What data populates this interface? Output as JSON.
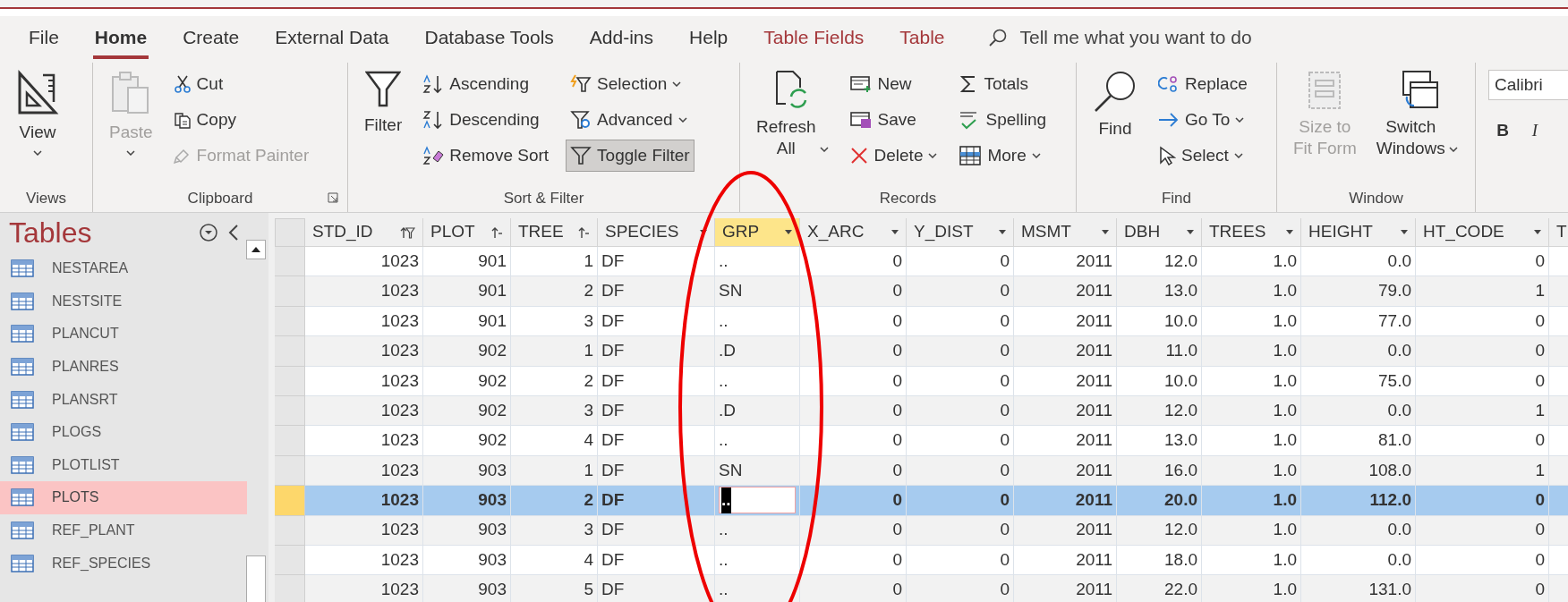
{
  "tabs": [
    {
      "label": "File",
      "selected": false,
      "kind": "normal"
    },
    {
      "label": "Home",
      "selected": true,
      "kind": "normal"
    },
    {
      "label": "Create",
      "selected": false,
      "kind": "normal"
    },
    {
      "label": "External Data",
      "selected": false,
      "kind": "normal"
    },
    {
      "label": "Database Tools",
      "selected": false,
      "kind": "normal"
    },
    {
      "label": "Add-ins",
      "selected": false,
      "kind": "normal"
    },
    {
      "label": "Help",
      "selected": false,
      "kind": "normal"
    },
    {
      "label": "Table Fields",
      "selected": false,
      "kind": "contextual"
    },
    {
      "label": "Table",
      "selected": false,
      "kind": "contextual"
    }
  ],
  "search": {
    "placeholder": "Tell me what you want to do"
  },
  "ribbon_groups": [
    {
      "label": "Views",
      "columns": [
        [
          {
            "label": "View",
            "caret": true
          }
        ]
      ]
    },
    {
      "label": "Clipboard",
      "launcher": true,
      "columns": [
        [
          {
            "label": "Paste",
            "caret": true,
            "disabled": true
          }
        ],
        [
          {
            "label": "Cut"
          },
          {
            "label": "Copy"
          },
          {
            "label": "Format Painter",
            "disabled": true
          }
        ]
      ]
    },
    {
      "label": "Sort & Filter",
      "columns": [
        [
          {
            "label": "Filter"
          }
        ],
        [
          {
            "label": "Ascending"
          },
          {
            "label": "Descending"
          },
          {
            "label": "Remove Sort"
          }
        ],
        [
          {
            "label": "Selection",
            "caret": true
          },
          {
            "label": "Advanced",
            "caret": true
          },
          {
            "label": "Toggle Filter",
            "pressed": true
          }
        ]
      ]
    },
    {
      "label": "Records",
      "columns": [
        [
          {
            "label": "Refresh\nAll",
            "caret": true
          }
        ],
        [
          {
            "label": "New"
          },
          {
            "label": "Save"
          },
          {
            "label": "Delete",
            "caret": true
          }
        ],
        [
          {
            "label": "Totals"
          },
          {
            "label": "Spelling"
          },
          {
            "label": "More",
            "caret": true
          }
        ]
      ]
    },
    {
      "label": "Find",
      "columns": [
        [
          {
            "label": "Find"
          }
        ],
        [
          {
            "label": "Replace"
          },
          {
            "label": "Go To",
            "caret": true
          },
          {
            "label": "Select",
            "caret": true
          }
        ]
      ]
    },
    {
      "label": "Window",
      "columns": [
        [
          {
            "label": "Size to\nFit Form",
            "disabled": true
          }
        ],
        [
          {
            "label": "Switch\nWindows",
            "caret": true
          }
        ]
      ]
    }
  ],
  "font_group": {
    "font": "Calibri",
    "buttons": [
      "B",
      "I"
    ]
  },
  "navigation": {
    "title": "Tables",
    "items": [
      {
        "label": "NESTAREA",
        "selected": false
      },
      {
        "label": "NESTSITE",
        "selected": false
      },
      {
        "label": "PLANCUT",
        "selected": false
      },
      {
        "label": "PLANRES",
        "selected": false
      },
      {
        "label": "PLANSRT",
        "selected": false
      },
      {
        "label": "PLOGS",
        "selected": false
      },
      {
        "label": "PLOTLIST",
        "selected": false
      },
      {
        "label": "PLOTS",
        "selected": true
      },
      {
        "label": "REF_PLANT",
        "selected": false
      },
      {
        "label": "REF_SPECIES",
        "selected": false
      }
    ]
  },
  "table": {
    "columns": [
      {
        "label": "STD_ID",
        "kind": "number",
        "sorted": true,
        "filtered": true,
        "selected": false
      },
      {
        "label": "PLOT",
        "kind": "number",
        "sorted": true,
        "selected": false
      },
      {
        "label": "TREE",
        "kind": "number",
        "sorted": true,
        "selected": false
      },
      {
        "label": "SPECIES",
        "kind": "text",
        "selected": false
      },
      {
        "label": "GRP",
        "kind": "text",
        "selected": true
      },
      {
        "label": "X_ARC",
        "kind": "number",
        "selected": false
      },
      {
        "label": "Y_DIST",
        "kind": "number",
        "selected": false
      },
      {
        "label": "MSMT",
        "kind": "number",
        "selected": false
      },
      {
        "label": "DBH",
        "kind": "number",
        "selected": false
      },
      {
        "label": "TREES",
        "kind": "number",
        "selected": false
      },
      {
        "label": "HEIGHT",
        "kind": "number",
        "selected": false
      },
      {
        "label": "HT_CODE",
        "kind": "number",
        "selected": false
      },
      {
        "label": "T",
        "kind": "cut",
        "selected": false
      }
    ],
    "rows": [
      {
        "selected": false,
        "cells": [
          "1023",
          "901",
          "1",
          "DF",
          "..",
          "0",
          "0",
          "2011",
          "12.0",
          "1.0",
          "0.0",
          "0"
        ]
      },
      {
        "selected": false,
        "cells": [
          "1023",
          "901",
          "2",
          "DF",
          "SN",
          "0",
          "0",
          "2011",
          "13.0",
          "1.0",
          "79.0",
          "1"
        ]
      },
      {
        "selected": false,
        "cells": [
          "1023",
          "901",
          "3",
          "DF",
          "..",
          "0",
          "0",
          "2011",
          "10.0",
          "1.0",
          "77.0",
          "0"
        ]
      },
      {
        "selected": false,
        "cells": [
          "1023",
          "902",
          "1",
          "DF",
          ".D",
          "0",
          "0",
          "2011",
          "11.0",
          "1.0",
          "0.0",
          "0"
        ]
      },
      {
        "selected": false,
        "cells": [
          "1023",
          "902",
          "2",
          "DF",
          "..",
          "0",
          "0",
          "2011",
          "10.0",
          "1.0",
          "75.0",
          "0"
        ]
      },
      {
        "selected": false,
        "cells": [
          "1023",
          "902",
          "3",
          "DF",
          ".D",
          "0",
          "0",
          "2011",
          "12.0",
          "1.0",
          "0.0",
          "1"
        ]
      },
      {
        "selected": false,
        "cells": [
          "1023",
          "902",
          "4",
          "DF",
          "..",
          "0",
          "0",
          "2011",
          "13.0",
          "1.0",
          "81.0",
          "0"
        ]
      },
      {
        "selected": false,
        "cells": [
          "1023",
          "903",
          "1",
          "DF",
          "SN",
          "0",
          "0",
          "2011",
          "16.0",
          "1.0",
          "108.0",
          "1"
        ]
      },
      {
        "selected": true,
        "cells": [
          "1023",
          "903",
          "2",
          "DF",
          "..",
          "0",
          "0",
          "2011",
          "20.0",
          "1.0",
          "112.0",
          "0"
        ]
      },
      {
        "selected": false,
        "cells": [
          "1023",
          "903",
          "3",
          "DF",
          "..",
          "0",
          "0",
          "2011",
          "12.0",
          "1.0",
          "0.0",
          "0"
        ]
      },
      {
        "selected": false,
        "cells": [
          "1023",
          "903",
          "4",
          "DF",
          "..",
          "0",
          "0",
          "2011",
          "18.0",
          "1.0",
          "0.0",
          "0"
        ]
      },
      {
        "selected": false,
        "cells": [
          "1023",
          "903",
          "5",
          "DF",
          "..",
          "0",
          "0",
          "2011",
          "22.0",
          "1.0",
          "131.0",
          "0"
        ]
      }
    ]
  }
}
